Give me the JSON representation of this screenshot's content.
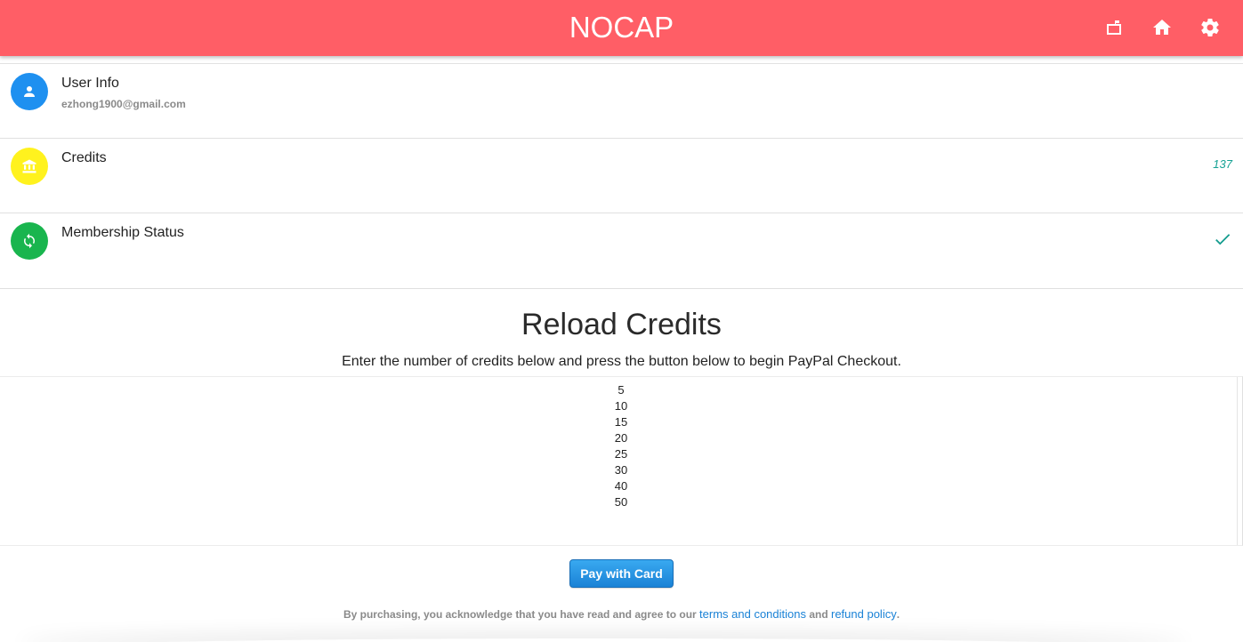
{
  "header": {
    "title": "NOCAP",
    "icons": [
      "mailbox-icon",
      "home-icon",
      "settings-icon"
    ],
    "background_color": "#ff5e66"
  },
  "list": {
    "user_info": {
      "label": "User Info",
      "email": "ezhong1900@gmail.com",
      "icon": "person-icon",
      "icon_color": "#1e90f0"
    },
    "credits": {
      "label": "Credits",
      "value": "137",
      "icon": "bank-icon",
      "icon_color": "#fff21e"
    },
    "membership": {
      "label": "Membership Status",
      "status_icon": "check-icon",
      "icon": "sync-icon",
      "icon_color": "#19b54e"
    }
  },
  "reload": {
    "title": "Reload Credits",
    "description": "Enter the number of credits below and press the button below to begin PayPal Checkout.",
    "options": [
      "5",
      "10",
      "15",
      "20",
      "25",
      "30",
      "40",
      "50"
    ]
  },
  "pay_button": {
    "label": "Pay with Card"
  },
  "legal": {
    "prefix": "By purchasing, you acknowledge that you have read and agree to our ",
    "terms_link": "terms and conditions",
    "middle": " and ",
    "refund_link": "refund policy",
    "suffix": "."
  }
}
